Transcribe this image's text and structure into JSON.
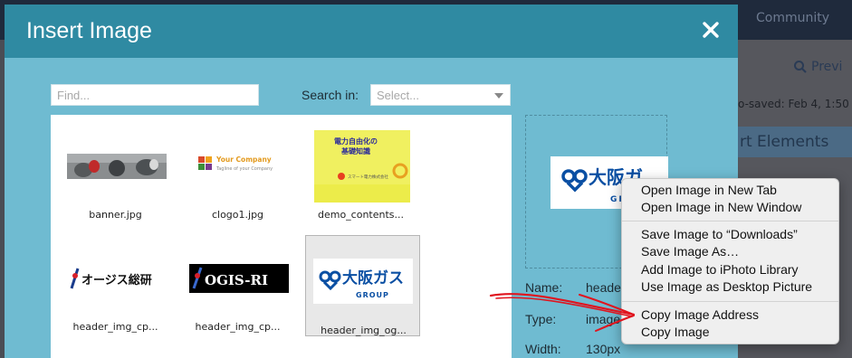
{
  "background": {
    "community_label": "Community",
    "preview_label": "Previ",
    "autosaved_label": "o-saved: Feb 4, 1:50",
    "elements_label": "rt Elements"
  },
  "dialog": {
    "title": "Insert Image",
    "close_icon": "close-icon",
    "find_placeholder": "Find...",
    "search_in_label": "Search in:",
    "select_placeholder": "Select..."
  },
  "images": [
    {
      "name": "banner.jpg"
    },
    {
      "name": "clogo1.jpg"
    },
    {
      "name": "demo_contents..."
    },
    {
      "name": "header_img_cp..."
    },
    {
      "name": "header_img_cp..."
    },
    {
      "name": "header_img_og..."
    }
  ],
  "thumb_text": {
    "your_company": "Your Company",
    "tagline": "Tagline of your Company",
    "demo_line1": "電力自由化の",
    "demo_line2": "基礎知識",
    "demo_line3": "スマート電力株式会社",
    "oasis": "オージス総研",
    "ogis": "OGIS-RI",
    "osaka_gas": "大阪ガス",
    "group": "GROUP",
    "preview_osaka": "大阪ガ",
    "preview_group": "GRO"
  },
  "details": {
    "name_label": "Name:",
    "name_value": "heade",
    "type_label": "Type:",
    "type_value": "image",
    "width_label": "Width:",
    "width_value": "130px"
  },
  "context_menu": {
    "items": [
      "Open Image in New Tab",
      "Open Image in New Window",
      "Save Image to “Downloads”",
      "Save Image As…",
      "Add Image to iPhoto Library",
      "Use Image as Desktop Picture",
      "Copy Image Address",
      "Copy Image"
    ]
  },
  "colors": {
    "dialog_header": "#2f8aa2",
    "dialog_body": "#6fbbd1",
    "annotation_red": "#e0141e",
    "osaka_blue": "#0a4fa3"
  }
}
